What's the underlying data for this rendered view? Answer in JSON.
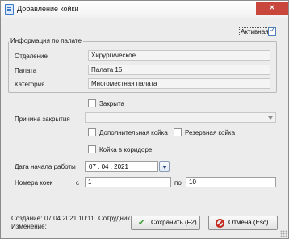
{
  "window": {
    "title": "Добавление койки",
    "close_icon": "close-icon"
  },
  "active_checkbox": {
    "label": "Активная",
    "checked": true
  },
  "ward_info": {
    "group_title": "Информация по палате",
    "department_label": "Отделение",
    "department_value": "Хирургическое",
    "ward_label": "Палата",
    "ward_value": "Палата 15",
    "category_label": "Категория",
    "category_value": "Многоместная палата"
  },
  "closed_checkbox": {
    "label": "Закрыта",
    "checked": false
  },
  "close_reason": {
    "label": "Причина закрытия",
    "value": ""
  },
  "additional_bed_checkbox": {
    "label": "Дополнительная койка",
    "checked": false
  },
  "reserve_bed_checkbox": {
    "label": "Резервная койка",
    "checked": false
  },
  "corridor_bed_checkbox": {
    "label": "Койка в коридоре",
    "checked": false
  },
  "start_date": {
    "label": "Дата начала работы",
    "value": "07 . 04 . 2021"
  },
  "bed_numbers": {
    "label": "Номера коек",
    "from_label": "с",
    "from_value": "1",
    "to_label": "по",
    "to_value": "10"
  },
  "footer": {
    "created_label": "Создание:",
    "created_value": "07.04.2021 10:11",
    "created_by": "Сотрудник",
    "modified_label": "Изменение:"
  },
  "buttons": {
    "save_label": "Сохранить (F2)",
    "cancel_label": "Отмена (Esc)"
  }
}
